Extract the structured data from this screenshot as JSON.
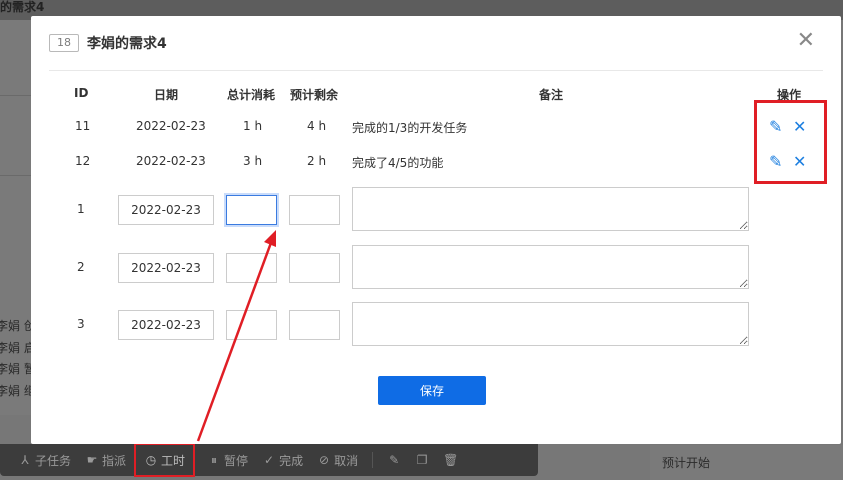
{
  "background": {
    "title": "的需求4",
    "history": [
      "李娟 创",
      "李娟 启",
      "李娟 暂",
      "李娟 继"
    ],
    "right_label": "预计开始"
  },
  "toolbar": {
    "subtask": "子任务",
    "assign": "指派",
    "hours": "工时",
    "pause": "暂停",
    "finish": "完成",
    "cancel": "取消"
  },
  "modal": {
    "id_badge": "18",
    "title": "李娟的需求4",
    "close_symbol": "✕",
    "columns": {
      "id": "ID",
      "date": "日期",
      "consumed": "总计消耗",
      "remaining": "预计剩余",
      "note": "备注",
      "actions": "操作"
    },
    "records": [
      {
        "id": "11",
        "date": "2022-02-23",
        "consumed": "1 h",
        "remaining": "4 h",
        "note": "完成的1/3的开发任务"
      },
      {
        "id": "12",
        "date": "2022-02-23",
        "consumed": "3 h",
        "remaining": "2 h",
        "note": "完成了4/5的功能"
      }
    ],
    "new_rows": [
      {
        "index": "1",
        "date": "2022-02-23",
        "consumed": "",
        "remaining": "",
        "note": ""
      },
      {
        "index": "2",
        "date": "2022-02-23",
        "consumed": "",
        "remaining": "",
        "note": ""
      },
      {
        "index": "3",
        "date": "2022-02-23",
        "consumed": "",
        "remaining": "",
        "note": ""
      }
    ],
    "save_label": "保存"
  },
  "colors": {
    "primary": "#0f6ce5",
    "annotation_red": "#e01e25",
    "icon_blue": "#1d7fe0"
  }
}
